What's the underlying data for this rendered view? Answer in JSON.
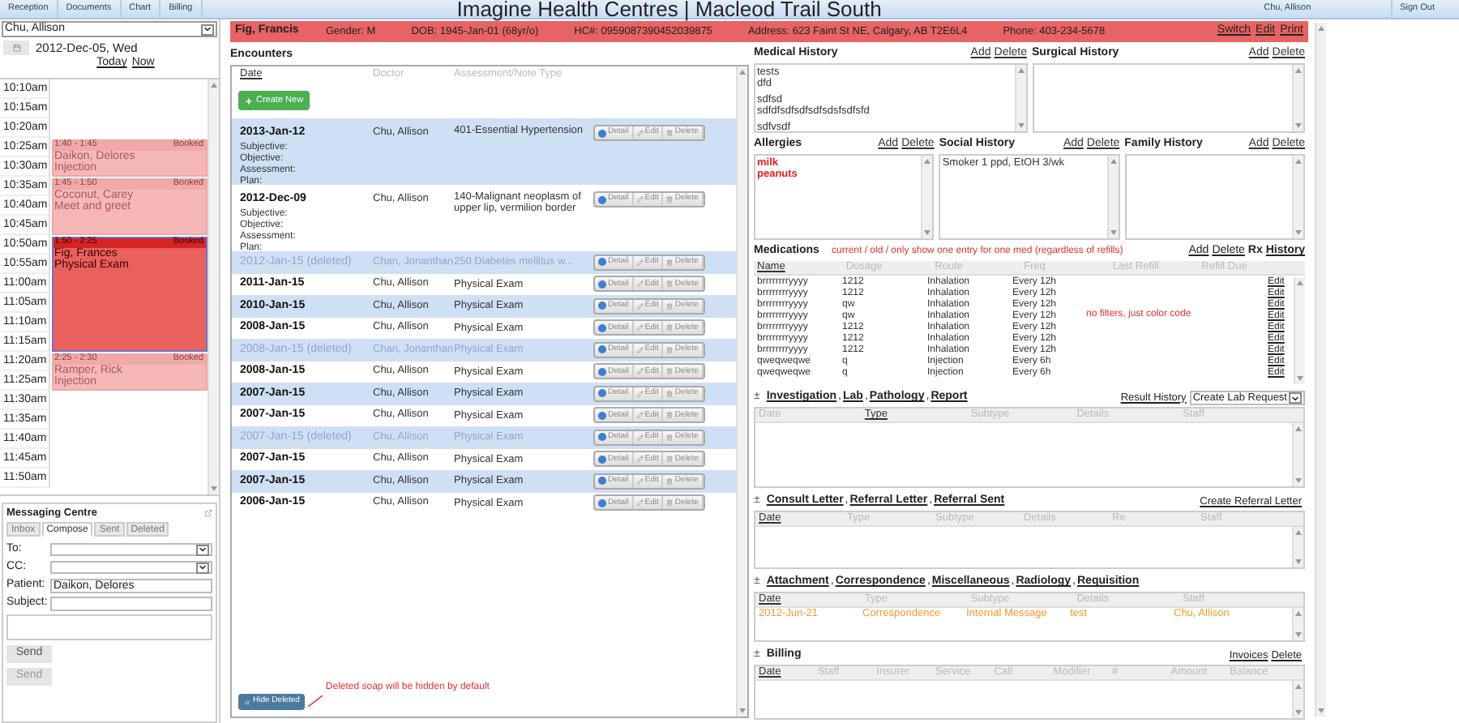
{
  "nav": {
    "tabs": [
      "Reception",
      "Documents",
      "Chart",
      "Billing"
    ]
  },
  "header": {
    "title": "Imagine Health Centres | Macleod Trail South",
    "user": "Chu, Allison",
    "sign_out": "Sign Out"
  },
  "patient": {
    "name": "Fig, Francis",
    "fields": [
      "Gender: M",
      "DOB: 1945-Jan-01 (68yr/o)",
      "HC#: 0959087390452039875",
      "Address: 623 Faint St NE, Calgary, AB T2E6L4",
      "Phone: 403-234-5678"
    ],
    "links": [
      "Switch",
      "Edit",
      "Print"
    ]
  },
  "schedule": {
    "provider": "Chu, Allison",
    "date": "2012-Dec-05, Wed",
    "today": "Today",
    "now": "Now",
    "blocks": [
      {
        "times": [
          "10:10am"
        ]
      },
      {
        "times": [
          "10:15am"
        ]
      },
      {
        "times": [
          "10:20am"
        ]
      },
      {
        "times": [
          "10:25am",
          "10:30am"
        ],
        "appointment": {
          "time": "1:40 - 1:45",
          "status": "Booked",
          "patient": "Daikon, Delores",
          "reason": "Injection",
          "selected": false
        }
      },
      {
        "times": [
          "10:35am",
          "10:40am",
          "10:45am"
        ],
        "appointment": {
          "time": "1:45 - 1:50",
          "status": "Booked",
          "patient": "Coconut, Carey",
          "reason": "Meet and greet",
          "selected": false
        }
      },
      {
        "times": [
          "10:50am",
          "10:55am",
          "11:00am",
          "11:05am",
          "11:10am",
          "11:15am"
        ],
        "appointment": {
          "time": "1:50 - 2:25",
          "status": "Booked",
          "patient": "Fig, Frances",
          "reason": "Physical Exam",
          "selected": true
        }
      },
      {
        "times": [
          "11:20am",
          "11:25am"
        ],
        "appointment": {
          "time": "2:25 - 2:30",
          "status": "Booked",
          "patient": "Ramper, Rick",
          "reason": "Injection",
          "selected": false
        }
      },
      {
        "times": [
          "11:30am"
        ]
      },
      {
        "times": [
          "11:35am"
        ]
      },
      {
        "times": [
          "11:40am"
        ]
      },
      {
        "times": [
          "11:45am"
        ]
      },
      {
        "times": [
          "11:50am"
        ]
      }
    ]
  },
  "messaging": {
    "title": "Messaging Centre",
    "tabs": [
      {
        "label": "Inbox",
        "selected": false
      },
      {
        "label": "Compose",
        "selected": true
      },
      {
        "label": "Sent",
        "selected": false
      },
      {
        "label": "Deleted",
        "selected": false
      }
    ],
    "fields": [
      {
        "label": "To:",
        "kind": "select"
      },
      {
        "label": "CC:",
        "kind": "select"
      },
      {
        "label": "Patient:",
        "kind": "text",
        "value": "Daikon, Delores"
      },
      {
        "label": "Subject:",
        "kind": "text"
      }
    ],
    "buttons": [
      "Send",
      "Send"
    ]
  },
  "encounters": {
    "title": "Encounters",
    "columns": [
      {
        "label": "Date",
        "active": true
      },
      {
        "label": "Doctor",
        "active": false
      },
      {
        "label": "Assessment/Note Type",
        "active": false
      }
    ],
    "create_button": "Create New",
    "rows": [
      {
        "date": "2013-Jan-12",
        "soap": [
          "Subjective:",
          "Objective:",
          "Assessment:",
          "Plan:"
        ],
        "doctor": "Chu, Allison",
        "assessment": "401-Essential Hypertension",
        "deleted": false,
        "actions": [
          "Detail",
          "Edit",
          "Delete"
        ]
      },
      {
        "date": "2012-Dec-09",
        "soap": [
          "Subjective:",
          "Objective:",
          "Assessment:",
          "Plan:"
        ],
        "doctor": "Chu, Allison",
        "assessment": "140-Malignant neoplasm of upper lip, vermilion border",
        "deleted": false,
        "actions": [
          "Detail",
          "Edit",
          "Delete"
        ]
      },
      {
        "date": "2012-Jan-15 (deleted)",
        "doctor": "Chan, Jonanthan",
        "assessment": "250 Diabetes mellitus w...",
        "deleted": true,
        "actions": [
          "Detail",
          "Edit",
          "Delete"
        ]
      },
      {
        "date": "2011-Jan-15",
        "doctor": "Chu, Allison",
        "assessment": "Physical Exam",
        "deleted": false,
        "actions": [
          "Detail",
          "Edit",
          "Delete"
        ]
      },
      {
        "date": "2010-Jan-15",
        "doctor": "Chu, Allison",
        "assessment": "Physical Exam",
        "deleted": false,
        "actions": [
          "Detail",
          "Edit",
          "Delete"
        ]
      },
      {
        "date": "2008-Jan-15",
        "doctor": "Chu, Allison",
        "assessment": "Physical Exam",
        "deleted": false,
        "actions": [
          "Detail",
          "Edit",
          "Delete"
        ]
      },
      {
        "date": "2008-Jan-15 (deleted)",
        "doctor": "Chan, Jonanthan",
        "assessment": "Physical Exam",
        "deleted": true,
        "actions": [
          "Detail",
          "Edit",
          "Delete"
        ]
      },
      {
        "date": "2008-Jan-15",
        "doctor": "Chu, Allison",
        "assessment": "Physical Exam",
        "deleted": false,
        "actions": [
          "Detail",
          "Edit",
          "Delete"
        ]
      },
      {
        "date": "2007-Jan-15",
        "doctor": "Chu, Allison",
        "assessment": "Physical Exam",
        "deleted": false,
        "actions": [
          "Detail",
          "Edit",
          "Delete"
        ]
      },
      {
        "date": "2007-Jan-15",
        "doctor": "Chu, Allison",
        "assessment": "Physical Exam",
        "deleted": false,
        "actions": [
          "Detail",
          "Edit",
          "Delete"
        ]
      },
      {
        "date": "2007-Jan-15 (deleted)",
        "doctor": "Chu, Allison",
        "assessment": "Physical Exam",
        "deleted": true,
        "actions": [
          "Detail",
          "Edit",
          "Delete"
        ]
      },
      {
        "date": "2007-Jan-15",
        "doctor": "Chu, Allison",
        "assessment": "Physical Exam",
        "deleted": false,
        "actions": [
          "Detail",
          "Edit",
          "Delete"
        ]
      },
      {
        "date": "2007-Jan-15",
        "doctor": "Chu, Allison",
        "assessment": "Physical Exam",
        "deleted": false,
        "actions": [
          "Detail",
          "Edit",
          "Delete"
        ]
      },
      {
        "date": "2006-Jan-15",
        "doctor": "Chu, Allison",
        "assessment": "Physical Exam",
        "deleted": false,
        "actions": [
          "Detail",
          "Edit",
          "Delete"
        ]
      }
    ],
    "hide_button": "Hide Deleted",
    "note": "Deleted soap will be hidden by default"
  },
  "history_rows": [
    [
      {
        "title": "Medical History",
        "links": [
          "Add",
          "Delete"
        ],
        "kind": "notes",
        "entries": [
          [
            "tests",
            "dfd"
          ],
          [
            "sdfsd",
            "sdfdfsdfsdfsdfsdsfsdfsfd"
          ],
          [
            "sdfvsdf"
          ]
        ]
      },
      {
        "title": "Surgical History",
        "links": [
          "Add",
          "Delete"
        ]
      }
    ],
    [
      {
        "title": "Allergies",
        "links": [
          "Add",
          "Delete"
        ],
        "kind": "alerts",
        "entries": [
          [
            "milk",
            "peanuts"
          ]
        ]
      },
      {
        "title": "Social History",
        "links": [
          "Add",
          "Delete"
        ],
        "kind": "notes",
        "entries": [
          [
            "Smoker 1 ppd, EtOH 3/wk"
          ]
        ]
      },
      {
        "title": "Family History",
        "links": [
          "Add",
          "Delete"
        ]
      }
    ]
  ],
  "medications": {
    "title": "Medications",
    "note": "current / old / only show one entry for one med (regardless of refills)",
    "links": [
      {
        "label": "Add",
        "kind": "link"
      },
      {
        "label": "Delete",
        "kind": "link"
      },
      {
        "label": "Rx",
        "kind": "bold"
      },
      {
        "label": "History",
        "kind": "bold_link"
      }
    ],
    "columns": [
      {
        "label": "Name",
        "active": true
      },
      {
        "label": "Dosage",
        "active": false
      },
      {
        "label": "Route",
        "active": false
      },
      {
        "label": "Freq",
        "active": false
      },
      {
        "label": "Last Refill",
        "active": false
      },
      {
        "label": "Refill Due",
        "active": false
      }
    ],
    "rows": [
      {
        "cells": [
          "brrrrrrrryyyy",
          "1212",
          "Inhalation",
          "Every 12h"
        ],
        "action": "Edit"
      },
      {
        "cells": [
          "brrrrrrrryyyy",
          "1212",
          "Inhalation",
          "Every 12h"
        ],
        "action": "Edit"
      },
      {
        "cells": [
          "brrrrrrrryyyy",
          "qw",
          "Inhalation",
          "Every 12h"
        ],
        "action": "Edit"
      },
      {
        "cells": [
          "brrrrrrrryyyy",
          "qw",
          "Inhalation",
          "Every 12h"
        ],
        "action": "Edit"
      },
      {
        "cells": [
          "brrrrrrrryyyy",
          "1212",
          "Inhalation",
          "Every 12h"
        ],
        "action": "Edit"
      },
      {
        "cells": [
          "brrrrrrrryyyy",
          "1212",
          "Inhalation",
          "Every 12h"
        ],
        "action": "Edit"
      },
      {
        "cells": [
          "brrrrrrrryyyy",
          "1212",
          "Inhalation",
          "Every 12h"
        ],
        "action": "Edit"
      },
      {
        "cells": [
          "qweqweqwe",
          "q",
          "Injection",
          "Every 6h"
        ],
        "action": "Edit"
      },
      {
        "cells": [
          "qweqweqwe",
          "q",
          "Injection",
          "Every 6h"
        ],
        "action": "Edit"
      }
    ],
    "side_note": "no filters, just color code"
  },
  "sections": [
    {
      "toggle": "±",
      "separators": [
        ",",
        ",",
        ","
      ],
      "links": [
        {
          "label": "Investigation",
          "kind": "link"
        },
        {
          "label": "Lab",
          "kind": "link"
        },
        {
          "label": "Pathology",
          "kind": "link"
        },
        {
          "label": "Report",
          "kind": "link"
        }
      ],
      "right": [
        {
          "label": "Result History",
          "kind": "link"
        },
        {
          "label": "Create Lab Request",
          "kind": "select"
        }
      ],
      "columns": [
        {
          "label": "Date",
          "active": false
        },
        {
          "label": "Type",
          "active": true
        },
        {
          "label": "Subtype",
          "active": false
        },
        {
          "label": "Details",
          "active": false
        },
        {
          "label": "Staff",
          "active": false
        }
      ]
    },
    {
      "toggle": "±",
      "separators": [
        ",",
        ","
      ],
      "links": [
        {
          "label": "Consult Letter",
          "kind": "link"
        },
        {
          "label": "Referral Letter",
          "kind": "link"
        },
        {
          "label": "Referral Sent",
          "kind": "link"
        }
      ],
      "right": [
        {
          "label": "Create Referral Letter",
          "kind": "link"
        }
      ],
      "columns": [
        {
          "label": "Date",
          "active": true
        },
        {
          "label": "Type",
          "active": false
        },
        {
          "label": "Subtype",
          "active": false
        },
        {
          "label": "Details",
          "active": false
        },
        {
          "label": "Re",
          "active": false
        },
        {
          "label": "Staff",
          "active": false
        }
      ]
    },
    {
      "toggle": "±",
      "separators": [
        ",",
        ",",
        ",",
        ","
      ],
      "links": [
        {
          "label": "Attachment",
          "kind": "link"
        },
        {
          "label": "Correspondence",
          "kind": "link"
        },
        {
          "label": "Miscellaneous",
          "kind": "link"
        },
        {
          "label": "Radiology",
          "kind": "link"
        },
        {
          "label": "Requisition",
          "kind": "link"
        }
      ],
      "columns": [
        {
          "label": "Date",
          "active": true
        },
        {
          "label": "Type",
          "active": false
        },
        {
          "label": "Subtype",
          "active": false
        },
        {
          "label": "Details",
          "active": false
        },
        {
          "label": "Staff",
          "active": false
        }
      ],
      "rows": [
        {
          "cells": [
            "2012-Jun-21",
            "Correspondence",
            "Internal Message",
            "test",
            "Chu, Allison"
          ],
          "color": "#f39a2b"
        }
      ]
    },
    {
      "toggle": "±",
      "links": [
        {
          "label": "Billing",
          "kind": "title"
        }
      ],
      "right": [
        {
          "label": "Invoices",
          "kind": "link"
        },
        {
          "label": "Delete",
          "kind": "link"
        }
      ],
      "columns": [
        {
          "label": "Date",
          "active": true
        },
        {
          "label": "Staff",
          "active": false
        },
        {
          "label": "Insurer",
          "active": false
        },
        {
          "label": "Service",
          "active": false
        },
        {
          "label": "Call",
          "active": false
        },
        {
          "label": "Modifier",
          "active": false
        },
        {
          "label": "#",
          "active": false
        },
        {
          "label": "Amount",
          "active": false
        },
        {
          "label": "Balance",
          "active": false
        }
      ]
    }
  ]
}
